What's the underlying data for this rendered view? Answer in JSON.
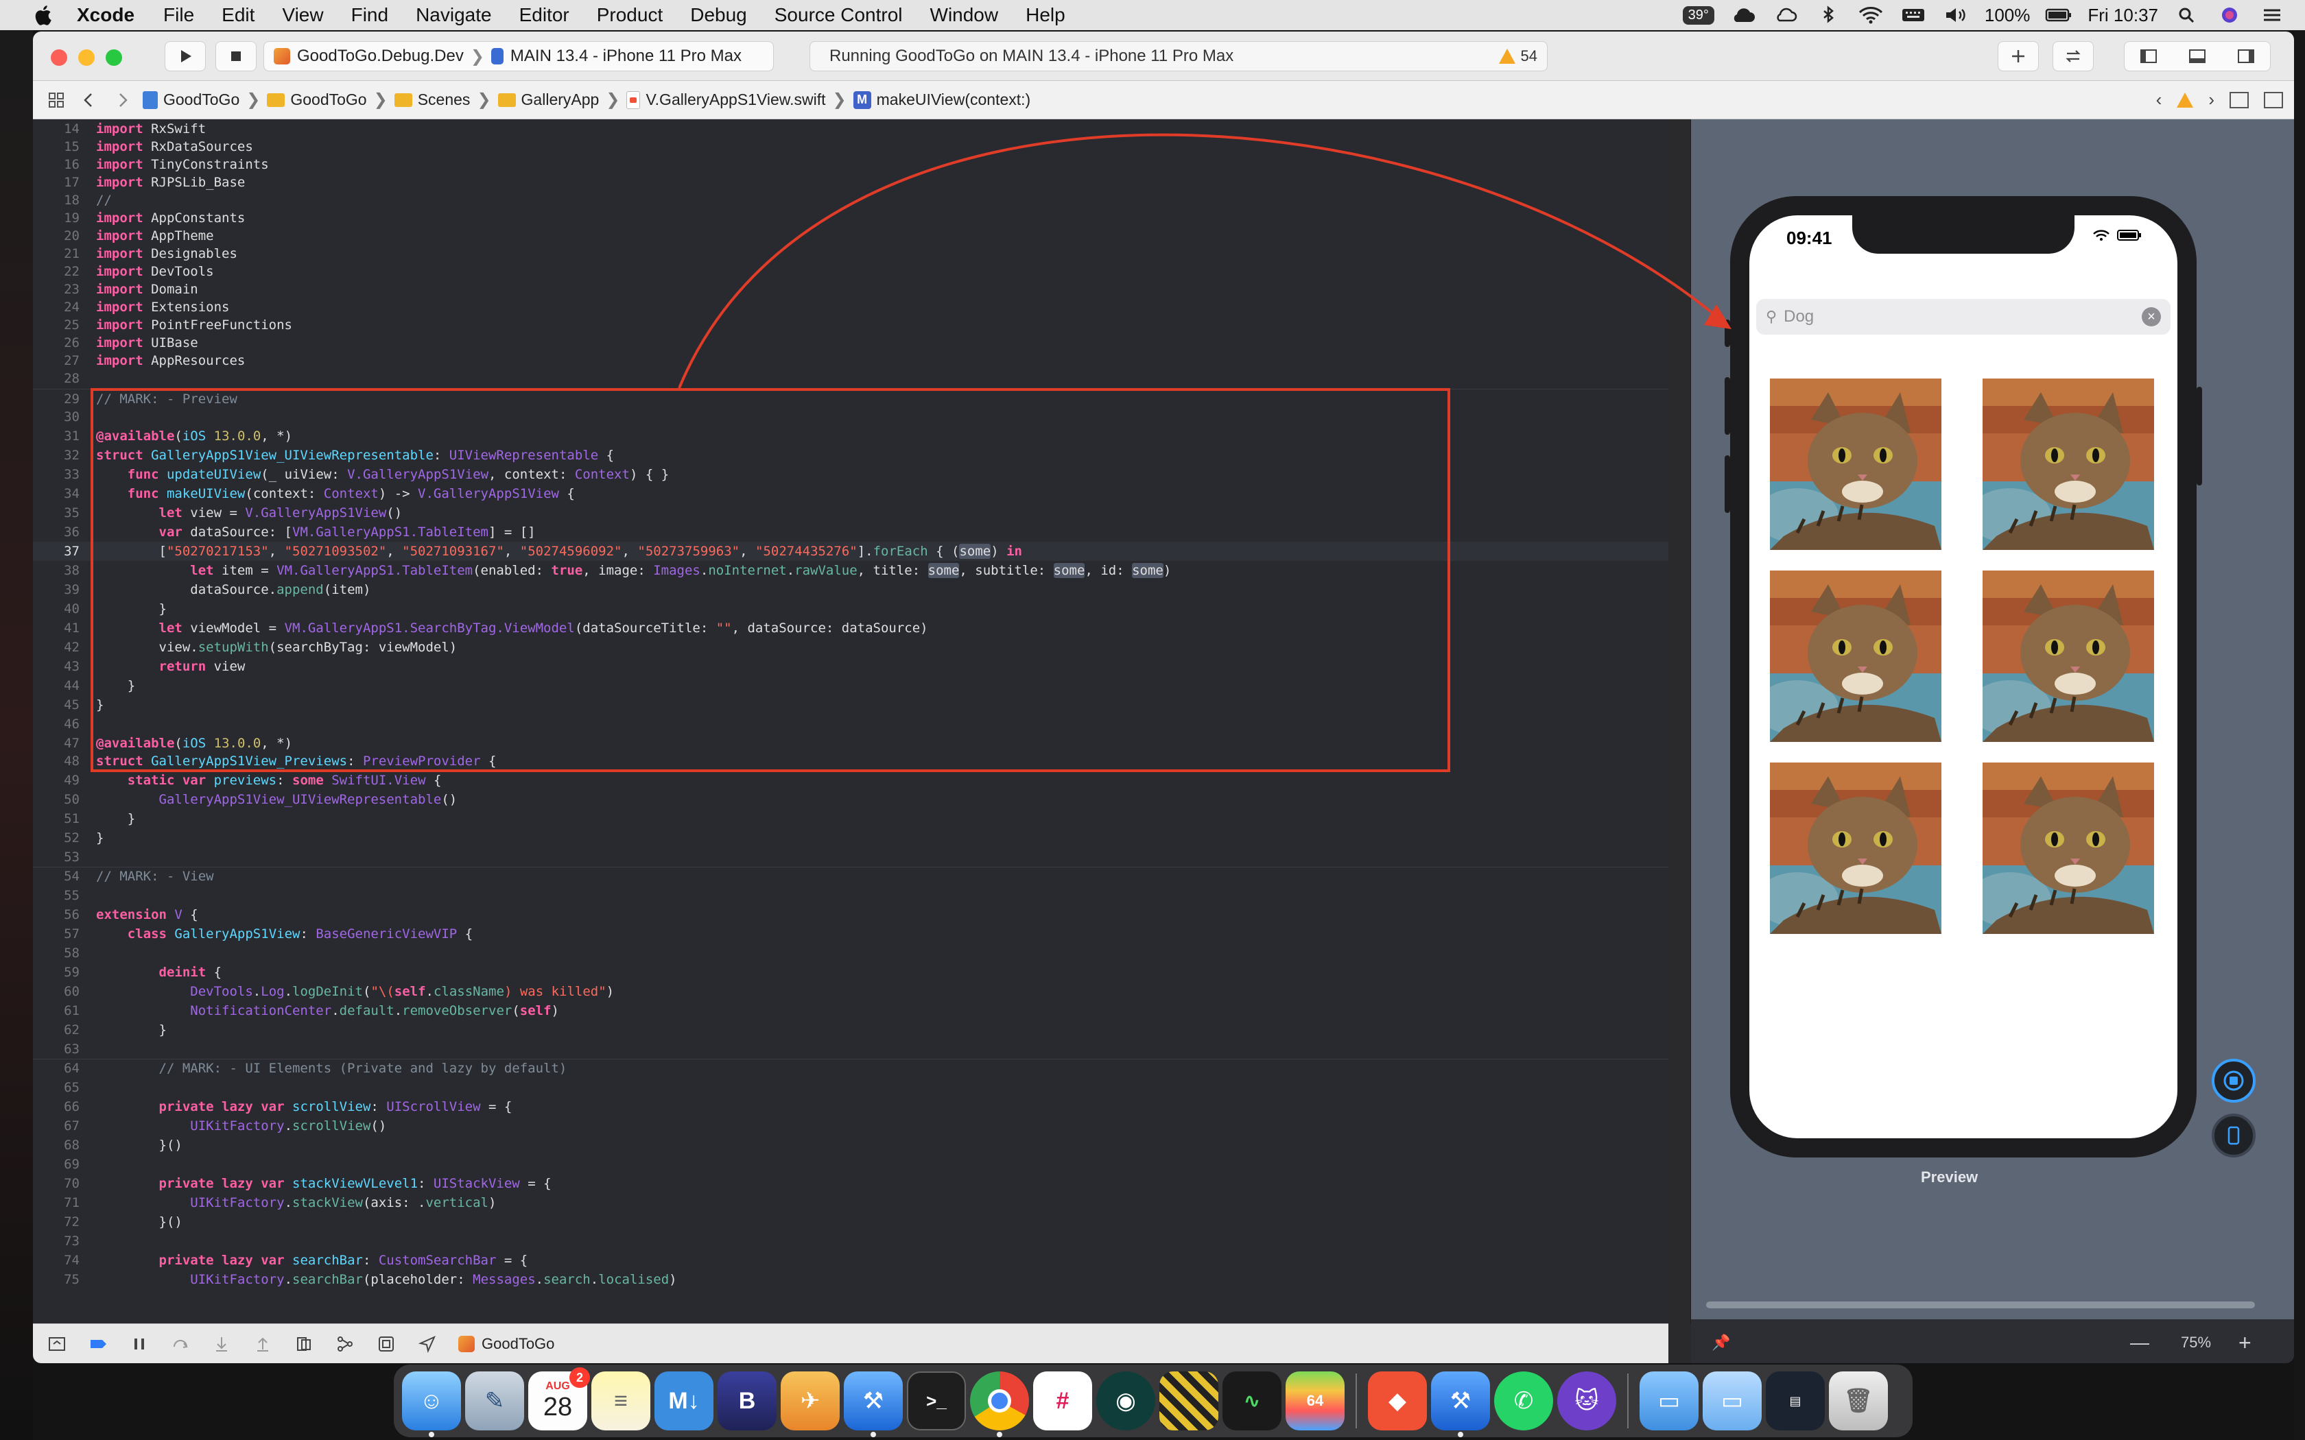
{
  "menubar": {
    "app_name": "Xcode",
    "items": [
      "File",
      "Edit",
      "View",
      "Find",
      "Navigate",
      "Editor",
      "Product",
      "Debug",
      "Source Control",
      "Window",
      "Help"
    ],
    "temperature": "39°",
    "battery_percent": "100%",
    "clock": "Fri 10:37"
  },
  "toolbar": {
    "scheme_name": "GoodToGo.Debug.Dev",
    "destination": "MAIN 13.4 - iPhone 11 Pro Max",
    "activity_text": "Running GoodToGo on MAIN 13.4 - iPhone 11 Pro Max",
    "warning_count": "54"
  },
  "jumpbar": {
    "crumbs": [
      "GoodToGo",
      "GoodToGo",
      "Scenes",
      "GalleryApp",
      "V.GalleryAppS1View.swift",
      "makeUIView(context:)"
    ]
  },
  "editor": {
    "current_line": "37",
    "line_numbers": [
      "14",
      "15",
      "16",
      "17",
      "18",
      "19",
      "20",
      "21",
      "22",
      "23",
      "24",
      "25",
      "26",
      "27",
      "28",
      "29",
      "30",
      "31",
      "32",
      "33",
      "34",
      "35",
      "36",
      "37",
      "38",
      "39",
      "40",
      "41",
      "42",
      "43",
      "44",
      "45",
      "46",
      "47",
      "48",
      "49",
      "50",
      "51",
      "52",
      "53",
      "54",
      "55",
      "56",
      "57",
      "58",
      "59",
      "60",
      "61",
      "62",
      "63",
      "64",
      "65",
      "66",
      "67",
      "68",
      "69",
      "70",
      "71",
      "72",
      "73",
      "74",
      "75"
    ],
    "imports_a": [
      "RxSwift",
      "RxDataSources",
      "TinyConstraints",
      "RJPSLib_Base"
    ],
    "imports_b": [
      "AppConstants",
      "AppTheme",
      "Designables",
      "DevTools",
      "Domain",
      "Extensions",
      "PointFreeFunctions",
      "UIBase",
      "AppResources"
    ],
    "ids": [
      "\"50270217153\"",
      "\"50271093502\"",
      "\"50271093167\"",
      "\"50274596092\"",
      "\"50273759963\"",
      "\"50274435276\""
    ]
  },
  "preview": {
    "time": "09:41",
    "search_text": "Dog",
    "label": "Preview",
    "zoom": "75%",
    "tile_count": 6
  },
  "debugbar": {
    "target": "GoodToGo"
  },
  "dock": {
    "calendar_month": "AUG",
    "calendar_day": "28",
    "calendar_badge": "2",
    "apps": [
      "Finder",
      "Preview",
      "Calendar",
      "Notes",
      "MindNode",
      "BBEdit",
      "Cyberduck",
      "Xcode",
      "Terminal",
      "Chrome",
      "Slack",
      "GitKraken",
      "Console",
      "Activity Monitor",
      "BlueStacks",
      "Git",
      "Simulator",
      "WhatsApp",
      "GitHub Desktop",
      "Applications",
      "Downloads",
      "Screenshots",
      "Trash"
    ]
  },
  "colors": {
    "editor_bg": "#292a30",
    "keyword": "#fc5fa3",
    "type": "#5dd8ff",
    "string": "#fc6a5d",
    "annotation_red": "#e03c28"
  }
}
